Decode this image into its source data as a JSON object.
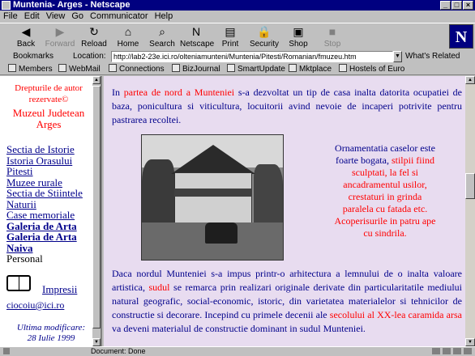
{
  "window": {
    "title": "Muntenia- Arges - Netscape",
    "minimize": "_",
    "maximize": "□",
    "close": "×"
  },
  "menu": [
    "File",
    "Edit",
    "View",
    "Go",
    "Communicator",
    "Help"
  ],
  "toolbar": [
    {
      "label": "Back",
      "icon": "back-arrow-icon",
      "glyph": "◀",
      "enabled": true
    },
    {
      "label": "Forward",
      "icon": "forward-arrow-icon",
      "glyph": "▶",
      "enabled": false
    },
    {
      "label": "Reload",
      "icon": "reload-icon",
      "glyph": "↻",
      "enabled": true
    },
    {
      "label": "Home",
      "icon": "home-icon",
      "glyph": "⌂",
      "enabled": true
    },
    {
      "label": "Search",
      "icon": "search-icon",
      "glyph": "⌕",
      "enabled": true
    },
    {
      "label": "Netscape",
      "icon": "netscape-icon",
      "glyph": "N",
      "enabled": true
    },
    {
      "label": "Print",
      "icon": "print-icon",
      "glyph": "▤",
      "enabled": true
    },
    {
      "label": "Security",
      "icon": "lock-icon",
      "glyph": "🔒",
      "enabled": true
    },
    {
      "label": "Shop",
      "icon": "shop-icon",
      "glyph": "▣",
      "enabled": true
    },
    {
      "label": "Stop",
      "icon": "stop-icon",
      "glyph": "■",
      "enabled": false
    }
  ],
  "logo": "N",
  "location": {
    "bookmarks": "Bookmarks",
    "label": "Location:",
    "url": "http://lab2-23e.ici.ro/olteniamunteni/Muntenia/Pitesti/Romanian/fmuzeu.htm",
    "related": "What's Related"
  },
  "personal": [
    "Members",
    "WebMail",
    "Connections",
    "BizJournal",
    "SmartUpdate",
    "Mktplace",
    "Hostels of Euro"
  ],
  "left": {
    "copyright": "Drepturile de autor rezervate©",
    "museum": "Muzeul Judetean Arges",
    "nav": [
      {
        "label": "Sectia de Istorie",
        "bold": false,
        "link": true
      },
      {
        "label": "Istoria Orasului Pitesti",
        "bold": false,
        "link": true
      },
      {
        "label": "Muzee rurale",
        "bold": false,
        "link": true
      },
      {
        "label": "Sectia de Stiintele Naturii",
        "bold": false,
        "link": true
      },
      {
        "label": "Case memoriale",
        "bold": false,
        "link": true
      },
      {
        "label": "Galeria de Arta",
        "bold": true,
        "link": true
      },
      {
        "label": "Galeria de Arta Naiva",
        "bold": true,
        "link": true
      },
      {
        "label": "Personal",
        "bold": false,
        "link": false
      }
    ],
    "impresii": "Impresii",
    "email": "ciocoiu@ici.ro",
    "modified_label": "Ultima modificare:",
    "modified_date": "28 Iulie 1999"
  },
  "main": {
    "p1_a": "In ",
    "p1_red": "partea de nord a Munteniei",
    "p1_b": " s-a dezvoltat un tip de casa inalta datorita ocupatiei de baza, ponicultura si viticultura, locuitorii avind nevoie de incaperi potrivite pentru pastrarea recoltei.",
    "orn_a": "Ornamentatia caselor este foarte bogata,",
    "orn_red": " stilpii fiind sculptati, la fel si ancadramentul usilor, crestaturi in grinda paralela cu fatada etc. Acoperisurile in patru ape cu sindrila.",
    "p2_a": "Daca nordul Munteniei s-a impus printr-o arhitectura a lemnului de o inalta valoare artistica, ",
    "p2_red1": "sudul",
    "p2_b": " se remarca prin realizari originale derivate din particularitatile mediului natural geografic, social-economic, istoric, din varietatea materialelor si tehnicilor de constructie si decorare. Incepind cu primele decenii ale ",
    "p2_red2": "secolului al XX-lea caramida arsa",
    "p2_c": " va deveni materialul de constructie dominant in sudul Munteniei."
  },
  "status": "Document: Done"
}
